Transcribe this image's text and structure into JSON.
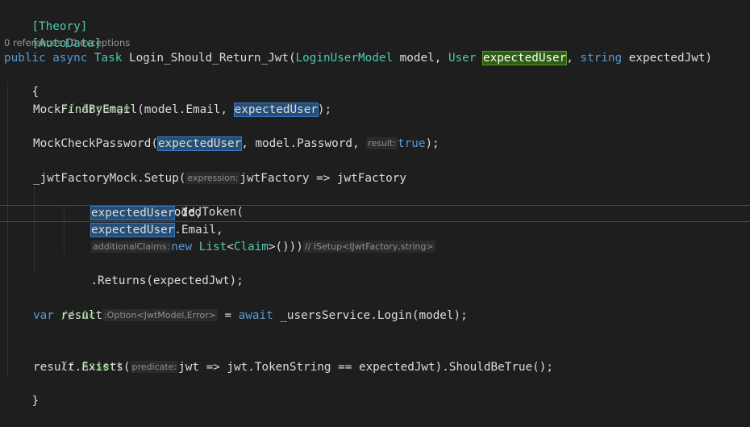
{
  "code": {
    "attr1": "[Theory]",
    "attr2": "[AutoData]",
    "codelens": {
      "references": "0 references",
      "sep": " | ",
      "exceptions": "0 exceptions"
    },
    "signature": {
      "public": "public",
      "async": "async",
      "task": "Task",
      "method": " Login_Should_Return_Jwt(",
      "model_type": "LoginUserModel",
      "model_param": " model, ",
      "user_type": "User",
      "expected_user": "expectedUser",
      "comma": ", ",
      "string_kw": "string",
      "tail": " expectedJwt)"
    },
    "open_brace": "{",
    "arrange_comment": "// Arrange",
    "find_by_email": {
      "prefix": "MockFindByEmail(model.Email, ",
      "arg": "expectedUser",
      "suffix": ");"
    },
    "check_password": {
      "prefix": "MockCheckPassword(",
      "arg": "expectedUser",
      "middle": ", model.Password, ",
      "hint": "result:",
      "value": "true",
      "suffix": ");"
    },
    "setup": {
      "prefix": "_jwtFactoryMock.Setup(",
      "hint": "expression:",
      "suffix": "jwtFactory => jwtFactory"
    },
    "generate": ".GenerateEncodedToken(",
    "arg_id": {
      "name": "expectedUser",
      "suffix": ".Id,"
    },
    "arg_email": {
      "name": "expectedUser",
      "suffix": ".Email,"
    },
    "claims": {
      "hint": "additionalClaims:",
      "new_kw": "new",
      "list_type": "List",
      "lt": "<",
      "claim_type": "Claim",
      "close": ">()))",
      "type_hint": "// ISetup<IJwtFactory,string>"
    },
    "returns": ".Returns(expectedJwt);",
    "act_comment": "// Act",
    "act": {
      "var_kw": "var",
      "result": " result",
      "type_hint": ":Option<JwtModel,Error>",
      "eq": " = ",
      "await_kw": "await",
      "call": " _usersService.Login(model);"
    },
    "assert_comment": "// Assert",
    "assert": {
      "prefix": "result.Exists(",
      "hint": "predicate:",
      "suffix": "jwt => jwt.TokenString == expectedJwt).ShouldBeTrue();"
    },
    "close_brace": "}"
  },
  "colors": {
    "background": "#1e1e1e",
    "keyword": "#569cd6",
    "type": "#4ec9b0",
    "comment": "#57a64a",
    "highlight": "#264f78",
    "highlight_definition": "#2f5d12"
  }
}
